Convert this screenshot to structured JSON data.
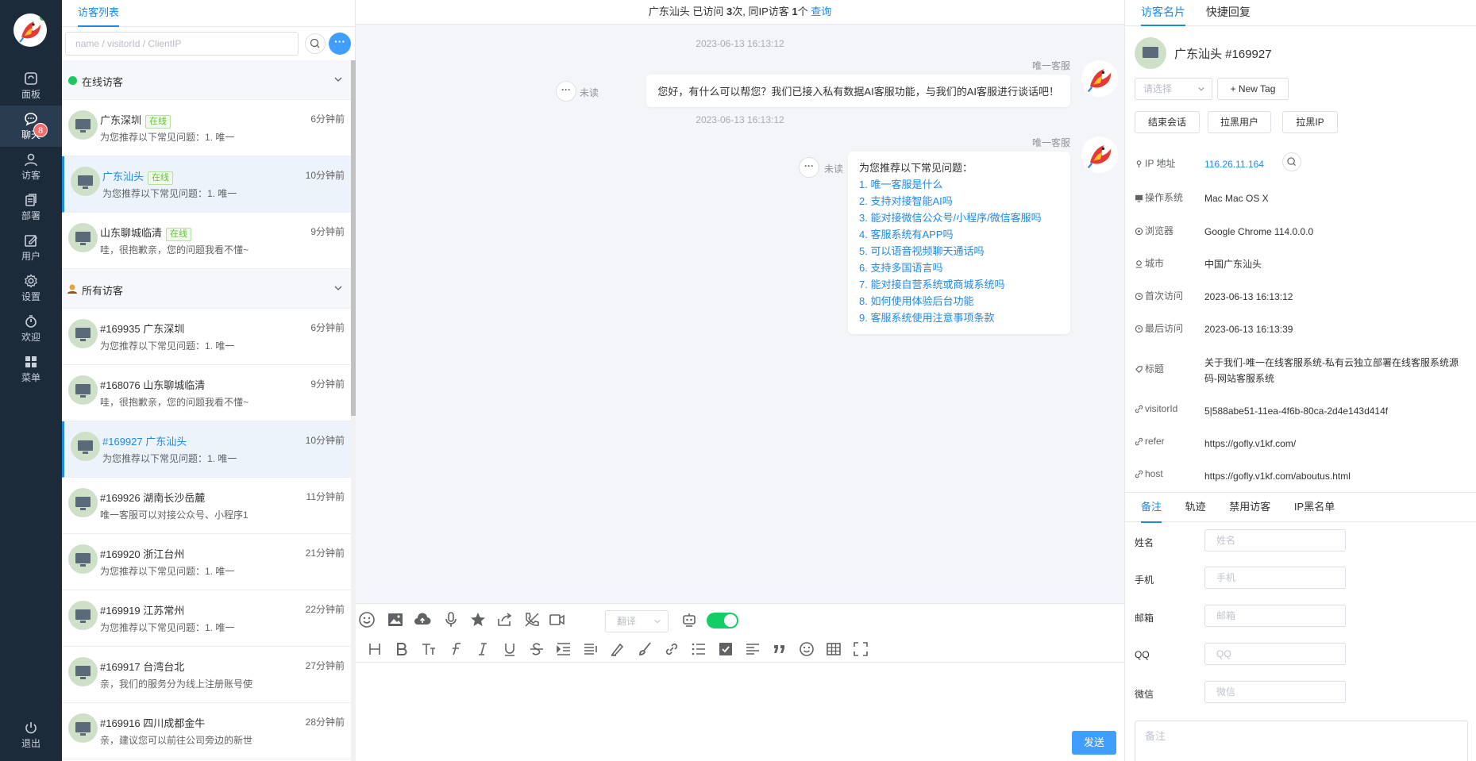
{
  "nav": {
    "items": [
      {
        "label": "面板",
        "icon": "dashboard-icon"
      },
      {
        "label": "聊天",
        "icon": "chat-icon",
        "badge": "8"
      },
      {
        "label": "访客",
        "icon": "visitor-icon"
      },
      {
        "label": "部署",
        "icon": "deploy-icon"
      },
      {
        "label": "用户",
        "icon": "user-edit-icon"
      },
      {
        "label": "设置",
        "icon": "gear-icon"
      },
      {
        "label": "欢迎",
        "icon": "timer-icon"
      },
      {
        "label": "菜单",
        "icon": "grid-menu-icon"
      }
    ],
    "logout_label": "退出"
  },
  "visitor_list": {
    "tab_label": "访客列表",
    "search_placeholder": "name / visitorId / ClientIP",
    "more_label": "···",
    "online_group": {
      "title": "在线访客",
      "items": [
        {
          "name": "广东深圳",
          "online_tag": "在线",
          "time": "6分钟前",
          "msg": "为您推荐以下常见问题：1. 唯一"
        },
        {
          "name": "广东汕头",
          "online_tag": "在线",
          "time": "10分钟前",
          "msg": "为您推荐以下常见问题：1. 唯一"
        },
        {
          "name": "山东聊城临清",
          "online_tag": "在线",
          "time": "9分钟前",
          "msg": "哇，很抱歉亲，您的问题我看不懂~"
        }
      ]
    },
    "all_group": {
      "title": "所有访客",
      "items": [
        {
          "name": "#169935 广东深圳",
          "time": "6分钟前",
          "msg": "为您推荐以下常见问题：1. 唯一"
        },
        {
          "name": "#168076 山东聊城临清",
          "time": "9分钟前",
          "msg": "哇，很抱歉亲，您的问题我看不懂~"
        },
        {
          "name": "#169927 广东汕头",
          "time": "10分钟前",
          "msg": "为您推荐以下常见问题：1. 唯一"
        },
        {
          "name": "#169926 湖南长沙岳麓",
          "time": "11分钟前",
          "msg": "唯一客服可以对接公众号、小程序1"
        },
        {
          "name": "#169920 浙江台州",
          "time": "21分钟前",
          "msg": "为您推荐以下常见问题：1. 唯一"
        },
        {
          "name": "#169919 江苏常州",
          "time": "22分钟前",
          "msg": "为您推荐以下常见问题：1. 唯一"
        },
        {
          "name": "#169917 台湾台北",
          "time": "27分钟前",
          "msg": "亲，我们的服务分为线上注册账号使"
        },
        {
          "name": "#169916 四川成都金牛",
          "time": "28分钟前",
          "msg": "亲，建议您可以前往公司旁边的新世"
        }
      ]
    }
  },
  "chat": {
    "header": {
      "location": "广东汕头",
      "visited_prefix": "已访问",
      "visits": "3",
      "visits_suffix": "次,",
      "same_ip_prefix": "同IP访客",
      "same_ip_count": "1",
      "same_ip_suffix": "个",
      "query_link": "查询"
    },
    "messages": [
      {
        "time": "2023-06-13 16:13:12",
        "agent": "唯一客服",
        "status": "未读",
        "text": "您好，有什么可以帮您？我们已接入私有数据AI客服功能，与我们的AI客服进行谈话吧！"
      },
      {
        "time": "2023-06-13 16:13:12",
        "agent": "唯一客服",
        "status": "未读",
        "intro": "为您推荐以下常见问题：",
        "questions": [
          "1. 唯一客服是什么",
          "2. 支持对接智能AI吗",
          "3. 能对接微信公众号/小程序/微信客服吗",
          "4. 客服系统有APP吗",
          "5. 可以语音视频聊天通话吗",
          "6. 支持多国语言吗",
          "7. 能对接自营系统或商城系统吗",
          "8. 如何使用体验后台功能",
          "9. 客服系统使用注意事项条款"
        ]
      }
    ],
    "translate_placeholder": "翻译",
    "send_label": "发送"
  },
  "right_panel": {
    "tabs": [
      "访客名片",
      "快捷回复"
    ],
    "card_title": "广东汕头 #169927",
    "tag_select_placeholder": "请选择",
    "new_tag_label": "+ New Tag",
    "actions": [
      "结束会话",
      "拉黑用户",
      "拉黑IP"
    ],
    "info": [
      {
        "label": "IP 地址",
        "value": "116.26.11.164",
        "icon": "location-icon"
      },
      {
        "label": "操作系统",
        "value": "Mac Mac OS X",
        "icon": "monitor-icon"
      },
      {
        "label": "浏览器",
        "value": "Google Chrome 114.0.0.0",
        "icon": "browser-icon"
      },
      {
        "label": "城市",
        "value": "中国广东汕头",
        "icon": "map-pin-icon"
      },
      {
        "label": "首次访问",
        "value": "2023-06-13 16:13:12",
        "icon": "clock-icon"
      },
      {
        "label": "最后访问",
        "value": "2023-06-13 16:13:39",
        "icon": "clock-icon"
      },
      {
        "label": "标题",
        "value": "关于我们-唯一在线客服系统-私有云独立部署在线客服系统源码-网站客服系统",
        "icon": "tag-icon"
      },
      {
        "label": "visitorId",
        "value": "5|588abe51-11ea-4f6b-80ca-2d4e143d414f",
        "icon": "link-icon"
      },
      {
        "label": "refer",
        "value": "https://gofly.v1kf.com/",
        "icon": "link-icon"
      },
      {
        "label": "host",
        "value": "https://gofly.v1kf.com/aboutus.html",
        "icon": "link-icon"
      }
    ],
    "bottom_tabs": [
      "备注",
      "轨迹",
      "禁用访客",
      "IP黑名单"
    ],
    "form": [
      {
        "label": "姓名",
        "placeholder": "姓名"
      },
      {
        "label": "手机",
        "placeholder": "手机"
      },
      {
        "label": "邮箱",
        "placeholder": "邮箱"
      },
      {
        "label": "QQ",
        "placeholder": "QQ"
      },
      {
        "label": "微信",
        "placeholder": "微信"
      }
    ],
    "remark_placeholder": "备注"
  },
  "colors": {
    "nav_bg": "#1c2b3a",
    "accent": "#1e88e5",
    "online": "#1ec760",
    "toggle": "#13ce66",
    "badge": "#f56c6c"
  }
}
